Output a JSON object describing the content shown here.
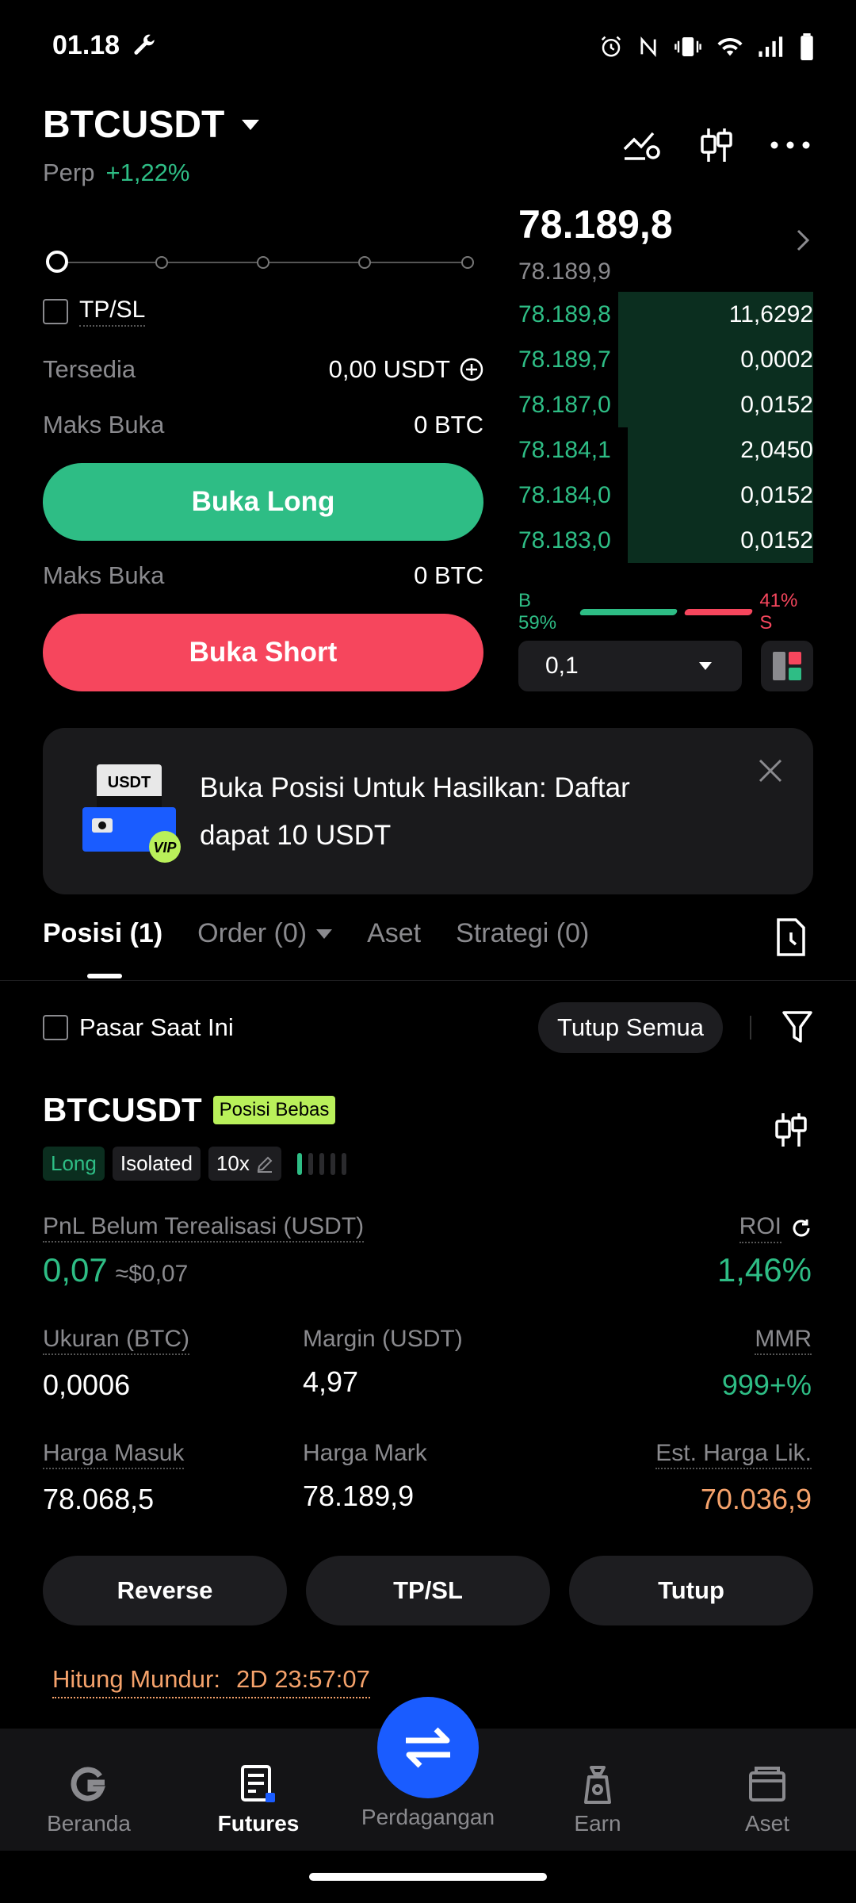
{
  "status_bar": {
    "time": "01.18"
  },
  "header": {
    "pair": "BTCUSDT",
    "type": "Perp",
    "change": "+1,22%"
  },
  "order_form": {
    "tpsl_label": "TP/SL",
    "available_label": "Tersedia",
    "available_value": "0,00 USDT",
    "max_open_label": "Maks Buka",
    "max_open_long": "0 BTC",
    "long_button": "Buka Long",
    "max_open_label_2": "Maks Buka",
    "max_open_short": "0 BTC",
    "short_button": "Buka Short"
  },
  "order_book": {
    "last_price": "78.189,8",
    "mark_price": "78.189,9",
    "rows": [
      {
        "price": "78.189,8",
        "qty": "11,6292",
        "depth": 0.34
      },
      {
        "price": "78.189,7",
        "qty": "0,0002",
        "depth": 0.34
      },
      {
        "price": "78.187,0",
        "qty": "0,0152",
        "depth": 0.34
      },
      {
        "price": "78.184,1",
        "qty": "2,0450",
        "depth": 0.37
      },
      {
        "price": "78.184,0",
        "qty": "0,0152",
        "depth": 0.37
      },
      {
        "price": "78.183,0",
        "qty": "0,0152",
        "depth": 0.37
      }
    ],
    "buy_ratio": "B 59%",
    "sell_ratio": "41% S",
    "buy_percent": 59,
    "precision": "0,1"
  },
  "banner": {
    "text": "Buka Posisi Untuk Hasilkan: Daftar dapat 10 USDT",
    "logo_text": "USDT",
    "vip_text": "VIP"
  },
  "tabs": [
    "Posisi (1)",
    "Order (0)",
    "Aset",
    "Strategi (0)"
  ],
  "filters": {
    "current_market": "Pasar Saat Ini",
    "close_all": "Tutup Semua"
  },
  "position": {
    "pair": "BTCUSDT",
    "badge": "Posisi Bebas",
    "side": "Long",
    "margin_mode": "Isolated",
    "leverage": "10x",
    "pnl_label": "PnL Belum Terealisasi (USDT)",
    "pnl_value": "0,07",
    "pnl_approx": "≈$0,07",
    "roi_label": "ROI",
    "roi_value": "1,46%",
    "size_label": "Ukuran (BTC)",
    "size_value": "0,0006",
    "margin_label": "Margin (USDT)",
    "margin_value": "4,97",
    "mmr_label": "MMR",
    "mmr_value": "999+%",
    "entry_label": "Harga Masuk",
    "entry_value": "78.068,5",
    "mark_label": "Harga Mark",
    "mark_value": "78.189,9",
    "liq_label": "Est. Harga Lik.",
    "liq_value": "70.036,9",
    "actions": [
      "Reverse",
      "TP/SL",
      "Tutup"
    ],
    "countdown_label": "Hitung Mundur:",
    "countdown_value": "2D 23:57:07"
  },
  "bottom_nav": [
    "Beranda",
    "Futures",
    "Perdagangan",
    "Earn",
    "Aset"
  ],
  "colors": {
    "green": "#2ebd85",
    "red": "#f6465d",
    "accent": "#1a5cff",
    "orange": "#f5a26b"
  }
}
